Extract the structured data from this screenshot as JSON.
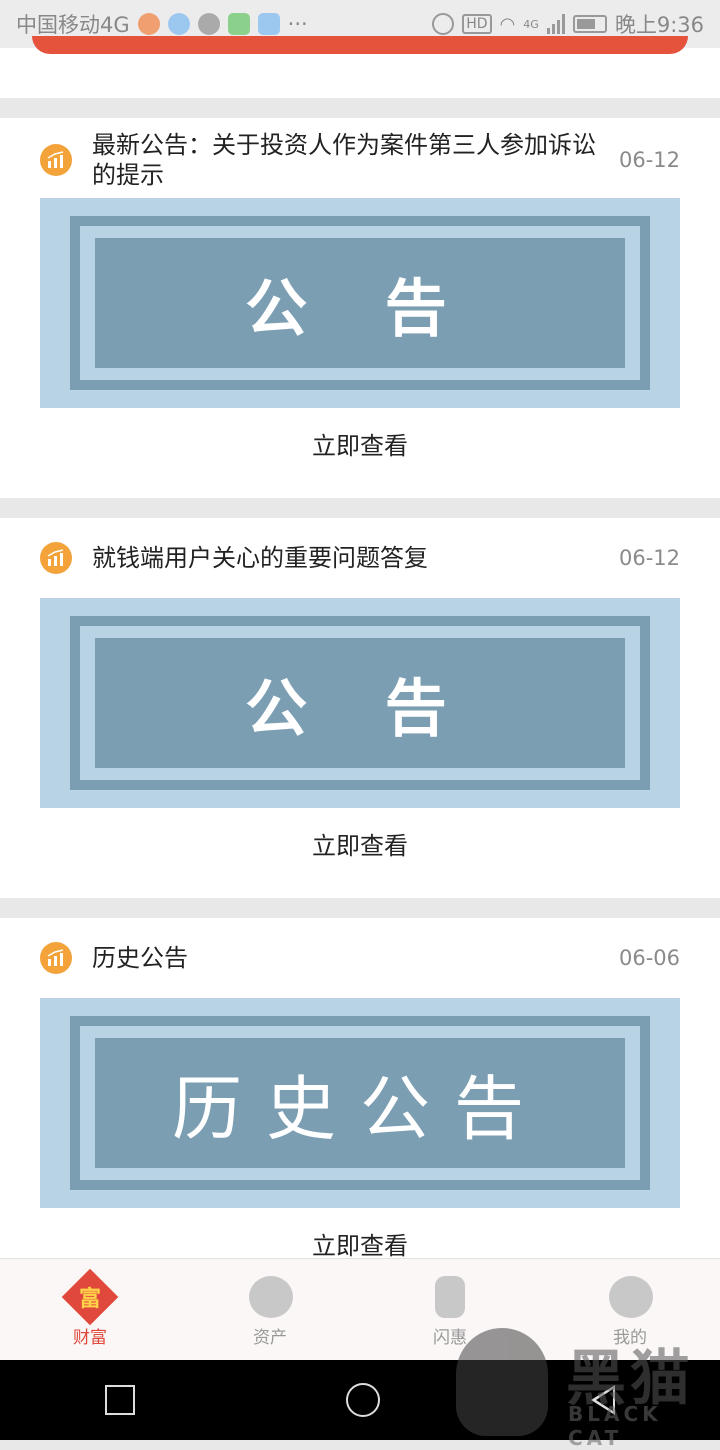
{
  "status_bar": {
    "carrier": "中国移动4G",
    "dots": "···",
    "hd": "HD",
    "network": "4G",
    "time": "晚上9:36"
  },
  "cards": [
    {
      "title": "最新公告：关于投资人作为案件第三人参加诉讼的提示",
      "date": "06-12",
      "banner_text": "公 告",
      "button": "立即查看"
    },
    {
      "title": "就钱端用户关心的重要问题答复",
      "date": "06-12",
      "banner_text": "公 告",
      "button": "立即查看"
    },
    {
      "title": "历史公告",
      "date": "06-06",
      "banner_text": "历史公告",
      "button": "立即查看"
    }
  ],
  "bottom_nav": {
    "items": [
      {
        "label": "财富",
        "icon": "fu-icon",
        "glyph": "富",
        "active": true
      },
      {
        "label": "资产",
        "icon": "asset-icon",
        "active": false
      },
      {
        "label": "闪惠",
        "icon": "shanhui-icon",
        "active": false
      },
      {
        "label": "我的",
        "icon": "profile-icon",
        "active": false
      }
    ]
  },
  "watermark": {
    "title": "黑猫",
    "subtitle": "BLACK CAT"
  },
  "colors": {
    "accent": "#e0483b",
    "notice_icon": "#f3a33a",
    "banner_light": "#b8d3e3",
    "banner_dark": "#7c9eb3"
  }
}
